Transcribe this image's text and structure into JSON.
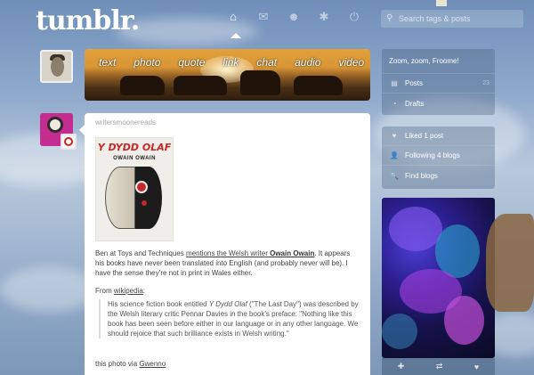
{
  "header": {
    "logo": "tumblr.",
    "search_placeholder": "Search tags & posts",
    "nav": [
      {
        "name": "home",
        "icon": "⌂"
      },
      {
        "name": "messages",
        "icon": "✉"
      },
      {
        "name": "account",
        "icon": "☻"
      },
      {
        "name": "settings",
        "icon": "✱"
      },
      {
        "name": "logout",
        "icon": "⏻"
      }
    ]
  },
  "post_types": [
    "text",
    "photo",
    "quote",
    "link",
    "chat",
    "audio",
    "video"
  ],
  "post": {
    "author": "writersmoonereads",
    "image": {
      "title": "Y DYDD OLAF",
      "author": "OWAIN OWAIN"
    },
    "body": {
      "intro": "Ben at Toys and Techniques ",
      "link1": "mentions the Welsh writer ",
      "link1_bold": "Owain Owain",
      "rest": ". It appears his books have never been translated into English (and probably never will be). I have the sense they’re not in print in Wales either."
    },
    "from_prefix": "From ",
    "from_link": "wikipedia",
    "from_suffix": ":",
    "quote": {
      "part1": "His science fiction book entitled ",
      "title": "Y Dydd Olaf",
      "part2": " (\"The Last Day\") was described by the Welsh literary critic Pennar Davies in the book's preface: \"Nothing like this book has been seen before either in our language or in any other language. We should rejoice that such brilliance exists in Welsh writing.\""
    },
    "via_prefix": "this photo via ",
    "via_link": "Gwenno"
  },
  "sidebar": {
    "blog_title": "Zoom, zoom, Froome!",
    "blog_items": [
      {
        "label": "Posts",
        "icon": "▤",
        "count": "23"
      },
      {
        "label": "Drafts",
        "icon": "◔",
        "count": ""
      }
    ],
    "account_items": [
      {
        "label": "Liked 1 post",
        "icon": "♥",
        "count": ""
      },
      {
        "label": "Following 4 blogs",
        "icon": "👤",
        "count": ""
      },
      {
        "label": "Find blogs",
        "icon": "🔍",
        "count": ""
      }
    ],
    "radar_footer": [
      {
        "name": "follow",
        "icon": "✚"
      },
      {
        "name": "reblog",
        "icon": "⇄"
      },
      {
        "name": "like",
        "icon": "♥"
      }
    ]
  }
}
